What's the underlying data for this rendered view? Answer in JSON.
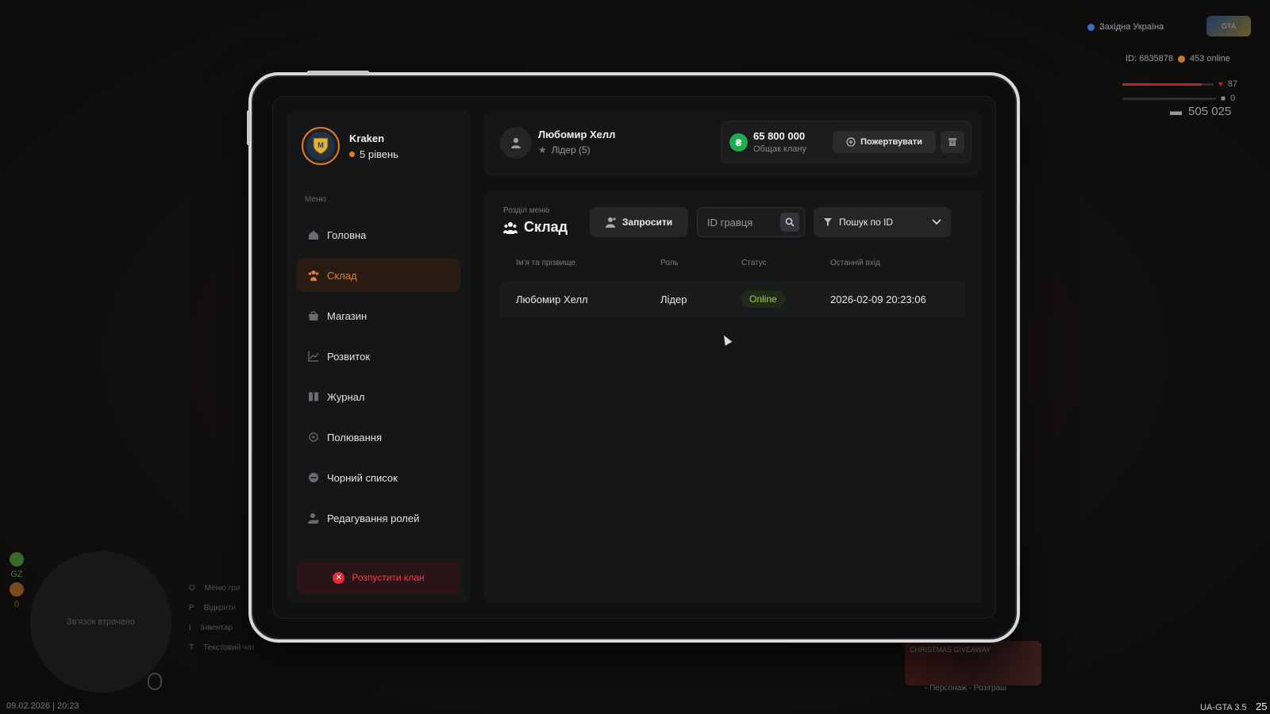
{
  "hud": {
    "region": "Західна Україна",
    "logo_text": "GTA",
    "player_id": "ID: 6835878",
    "online": "453 online",
    "health": "87",
    "armor": "0",
    "health_fill_pct": 87,
    "money": "505 025",
    "radar_text": "Зв'язок втрачено",
    "gz_label": "GZ",
    "wanted_value": "0",
    "keys": [
      {
        "key": "O",
        "label": "Меню гри"
      },
      {
        "key": "P",
        "label": "Відкрити"
      },
      {
        "key": "I",
        "label": "Інвентар"
      },
      {
        "key": "T",
        "label": "Текстовий чат"
      }
    ],
    "datetime": "09.02.2026 | 20:23",
    "version": "UA-GTA 3.5",
    "version_suffix": "25",
    "promo_title": "CHRISTMAS GIVEAWAY",
    "promo_hint": "- Персонаж - Розіграш"
  },
  "sidebar": {
    "clan_name": "Kraken",
    "clan_level": "5 рівень",
    "menu_label": "Меню",
    "items": [
      {
        "label": "Головна",
        "icon": "home-icon",
        "active": false
      },
      {
        "label": "Склад",
        "icon": "members-icon",
        "active": true
      },
      {
        "label": "Магазин",
        "icon": "shop-icon",
        "active": false
      },
      {
        "label": "Розвиток",
        "icon": "chart-icon",
        "active": false
      },
      {
        "label": "Журнал",
        "icon": "journal-icon",
        "active": false
      },
      {
        "label": "Полювання",
        "icon": "crosshair-icon",
        "active": false
      },
      {
        "label": "Чорний список",
        "icon": "block-icon",
        "active": false
      },
      {
        "label": "Редагування ролей",
        "icon": "role-icon",
        "active": false
      }
    ],
    "disband_label": "Розпустити клан"
  },
  "topbar": {
    "user_name": "Любомир Хелл",
    "user_role": "Лідер (5)",
    "treasury_amount": "65 800 000",
    "treasury_label": "Общак клану",
    "donate_label": "Пожертвувати"
  },
  "main": {
    "section_label": "Розділ меню",
    "section_title": "Склад",
    "invite_label": "Запросити",
    "id_placeholder": "ID гравця",
    "filter_label": "Пошук по ID",
    "columns": [
      "Ім'я та прізвище",
      "Роль",
      "Статус",
      "Останній вхід"
    ],
    "rows": [
      {
        "name": "Любомир Хелл",
        "role": "Лідер",
        "status": "Online",
        "last_login": "2026-02-09 20:23:06"
      }
    ]
  },
  "colors": {
    "accent": "#ec7d2f",
    "danger": "#e02e3a",
    "online": "#9fd43c",
    "coin": "#1eab52"
  }
}
